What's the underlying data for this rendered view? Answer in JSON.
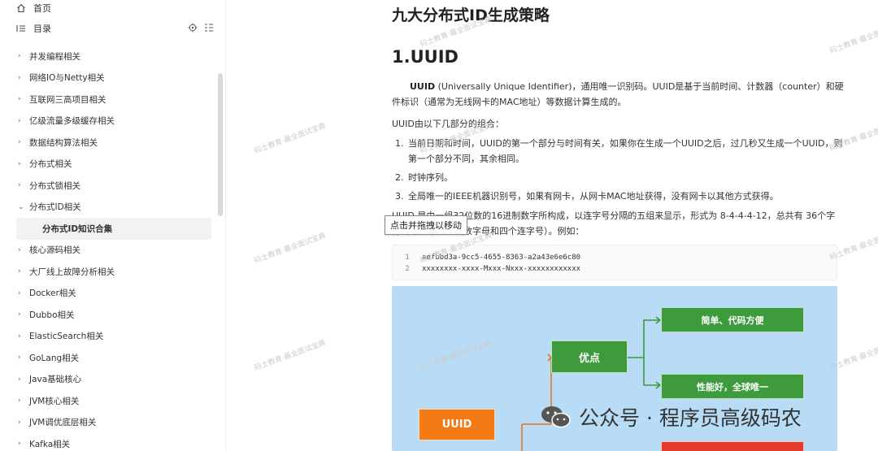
{
  "sidebar": {
    "home": "首页",
    "toc": "目录",
    "items": [
      {
        "label": "并发编程相关",
        "expanded": false
      },
      {
        "label": "网络IO与Netty相关",
        "expanded": false
      },
      {
        "label": "互联网三高项目相关",
        "expanded": false
      },
      {
        "label": "亿级流量多级缓存相关",
        "expanded": false
      },
      {
        "label": "数据结构算法相关",
        "expanded": false
      },
      {
        "label": "分布式相关",
        "expanded": false
      },
      {
        "label": "分布式锁相关",
        "expanded": false
      },
      {
        "label": "分布式ID相关",
        "expanded": true
      },
      {
        "label": "分布式ID知识合集",
        "sub": true
      },
      {
        "label": "核心源码相关",
        "expanded": false
      },
      {
        "label": "大厂线上故障分析相关",
        "expanded": false
      },
      {
        "label": "Docker相关",
        "expanded": false
      },
      {
        "label": "Dubbo相关",
        "expanded": false
      },
      {
        "label": "ElasticSearch相关",
        "expanded": false
      },
      {
        "label": "GoLang相关",
        "expanded": false
      },
      {
        "label": "Java基础核心",
        "expanded": false
      },
      {
        "label": "JVM核心相关",
        "expanded": false
      },
      {
        "label": "JVM调优底层相关",
        "expanded": false
      },
      {
        "label": "Kafka相关",
        "expanded": false
      }
    ]
  },
  "doc": {
    "title": "九大分布式ID生成策略",
    "heading": "1.UUID",
    "intro_bold": "UUID",
    "intro_rest": " (Universally Unique Identifier)，通用唯一识别码。UUID是基于当前时间、计数器（counter）和硬件标识（通常为无线网卡的MAC地址）等数据计算生成的。",
    "composition": "UUID由以下几部分的组合：",
    "list": [
      {
        "num": "1.",
        "text": "当前日期和时间，UUID的第一个部分与时间有关，如果你在生成一个UUID之后，过几秒又生成一个UUID，则第一个部分不同，其余相同。"
      },
      {
        "num": "2.",
        "text": "时钟序列。"
      },
      {
        "num": "3.",
        "text": "全局唯一的IEEE机器识别号，如果有网卡，从网卡MAC地址获得，没有网卡以其他方式获得。"
      }
    ],
    "format_line1": "UUID 是由一组32位数的16进制数字所构成，以连字号分隔的五组来显示，形式为 8-4-4-4-12，总共有 36个字",
    "format_line2": "符（即三十二个英数字母和四个连字号）。例如：",
    "tooltip": "点击并拖拽以移动",
    "code": [
      {
        "n": "1",
        "text": "aefbbd3a-9cc5-4655-8363-a2a43e6e6c80"
      },
      {
        "n": "2",
        "text": "xxxxxxxx-xxxx-Mxxx-Nxxx-xxxxxxxxxxxx"
      }
    ]
  },
  "diagram": {
    "root": "UUID",
    "pros": "优点",
    "pro1": "简单、代码方便",
    "pro2": "性能好，全球唯一",
    "bg_color": "#b9dcf6",
    "green": "#3d9a3d",
    "orange": "#f47a15",
    "red": "#e53b2f"
  },
  "watermark": "码士教育·最全面试宝典",
  "wechat": {
    "text": "公众号 · 程序员高级码农"
  }
}
